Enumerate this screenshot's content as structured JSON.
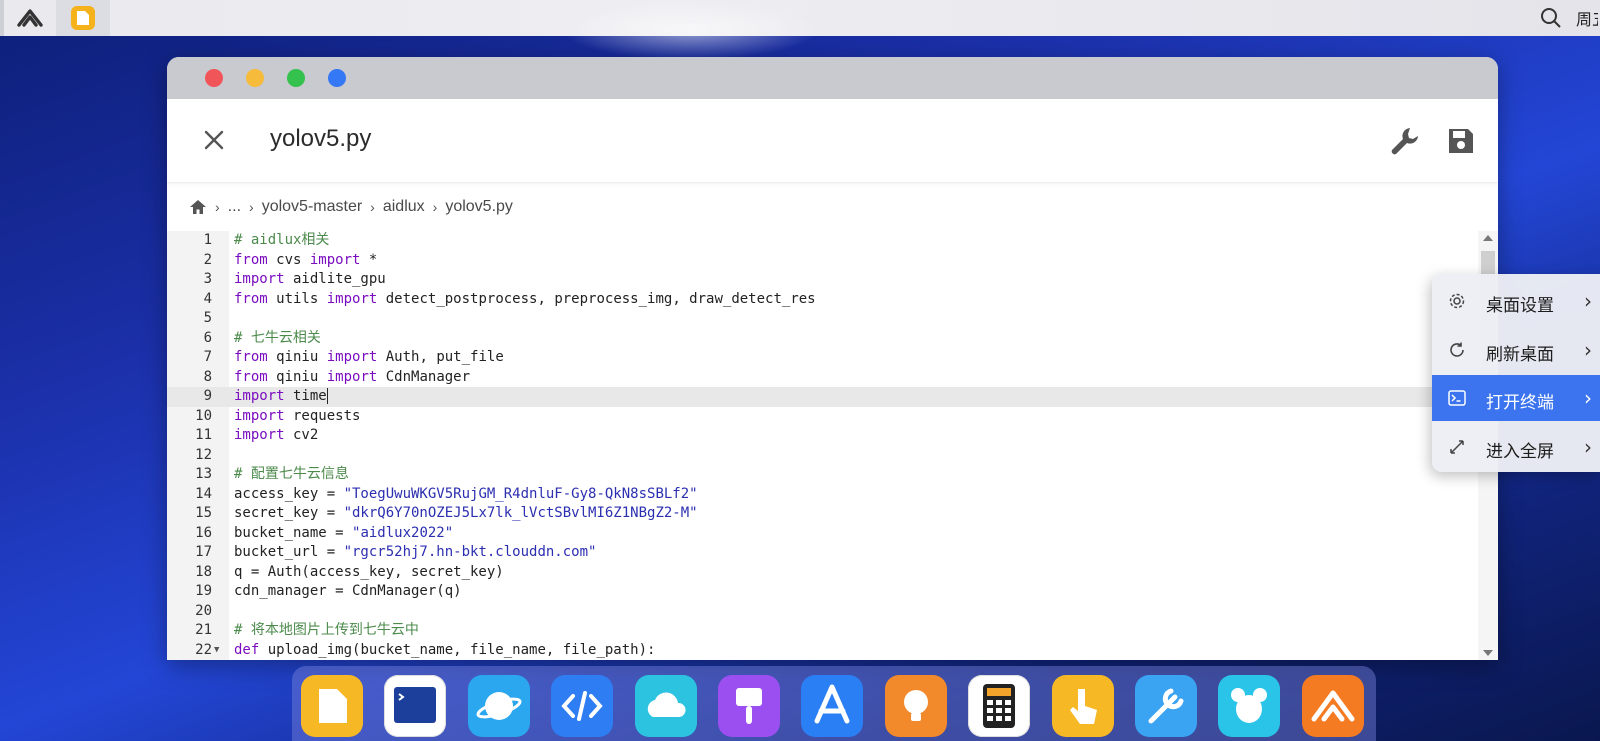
{
  "topbar": {
    "clock": "周五"
  },
  "editor": {
    "filename": "yolov5.py",
    "breadcrumb": [
      "...",
      "yolov5-master",
      "aidlux",
      "yolov5.py"
    ],
    "active_line": 9,
    "lines": [
      {
        "n": "1",
        "t": [
          [
            "cm",
            "# aidlux相关"
          ]
        ]
      },
      {
        "n": "2",
        "t": [
          [
            "kw",
            "from"
          ],
          [
            "p",
            " cvs "
          ],
          [
            "kw",
            "import"
          ],
          [
            "p",
            " *"
          ]
        ]
      },
      {
        "n": "3",
        "t": [
          [
            "kw",
            "import"
          ],
          [
            "p",
            " aidlite_gpu"
          ]
        ]
      },
      {
        "n": "4",
        "t": [
          [
            "kw",
            "from"
          ],
          [
            "p",
            " utils "
          ],
          [
            "kw",
            "import"
          ],
          [
            "p",
            " detect_postprocess, preprocess_img, draw_detect_res"
          ]
        ]
      },
      {
        "n": "5",
        "t": []
      },
      {
        "n": "6",
        "t": [
          [
            "cm",
            "# 七牛云相关"
          ]
        ]
      },
      {
        "n": "7",
        "t": [
          [
            "kw",
            "from"
          ],
          [
            "p",
            " qiniu "
          ],
          [
            "kw",
            "import"
          ],
          [
            "p",
            " Auth, put_file"
          ]
        ]
      },
      {
        "n": "8",
        "t": [
          [
            "kw",
            "from"
          ],
          [
            "p",
            " qiniu "
          ],
          [
            "kw",
            "import"
          ],
          [
            "p",
            " CdnManager"
          ]
        ]
      },
      {
        "n": "9",
        "t": [
          [
            "kw",
            "import"
          ],
          [
            "p",
            " time"
          ],
          [
            "cursor",
            ""
          ]
        ]
      },
      {
        "n": "10",
        "t": [
          [
            "kw",
            "import"
          ],
          [
            "p",
            " requests"
          ]
        ]
      },
      {
        "n": "11",
        "t": [
          [
            "kw",
            "import"
          ],
          [
            "p",
            " cv2"
          ]
        ]
      },
      {
        "n": "12",
        "t": []
      },
      {
        "n": "13",
        "t": [
          [
            "cm",
            "# 配置七牛云信息"
          ]
        ]
      },
      {
        "n": "14",
        "t": [
          [
            "p",
            "access_key = "
          ],
          [
            "st",
            "\"ToegUwuWKGV5RujGM_R4dnluF-Gy8-QkN8sSBLf2\""
          ]
        ]
      },
      {
        "n": "15",
        "t": [
          [
            "p",
            "secret_key = "
          ],
          [
            "st",
            "\"dkrQ6Y70nOZEJ5Lx7lk_lVctSBvlMI6Z1NBgZ2-M\""
          ]
        ]
      },
      {
        "n": "16",
        "t": [
          [
            "p",
            "bucket_name = "
          ],
          [
            "st",
            "\"aidlux2022\""
          ]
        ]
      },
      {
        "n": "17",
        "t": [
          [
            "p",
            "bucket_url = "
          ],
          [
            "st",
            "\"rgcr52hj7.hn-bkt.clouddn.com\""
          ]
        ]
      },
      {
        "n": "18",
        "t": [
          [
            "p",
            "q = Auth(access_key, secret_key)"
          ]
        ]
      },
      {
        "n": "19",
        "t": [
          [
            "p",
            "cdn_manager = CdnManager(q)"
          ]
        ]
      },
      {
        "n": "20",
        "t": []
      },
      {
        "n": "21",
        "t": [
          [
            "cm",
            "# 将本地图片上传到七牛云中"
          ]
        ]
      },
      {
        "n": "22",
        "fold": true,
        "t": [
          [
            "kw",
            "def"
          ],
          [
            "p",
            " upload_img(bucket_name, file_name, file_path):"
          ]
        ]
      }
    ]
  },
  "context_menu": {
    "items": [
      {
        "label": "桌面设置",
        "icon": "gear-icon",
        "selected": false
      },
      {
        "label": "刷新桌面",
        "icon": "refresh-icon",
        "selected": false
      },
      {
        "label": "打开终端",
        "icon": "terminal-icon",
        "selected": true
      },
      {
        "label": "进入全屏",
        "icon": "fullscreen-icon",
        "selected": false
      }
    ]
  },
  "dock": {
    "apps": [
      {
        "icon": "files-app-icon",
        "color": "#f7b825"
      },
      {
        "icon": "terminal-app-icon",
        "color": "#ffffff"
      },
      {
        "icon": "browser-planet-icon",
        "color": "#2aa7ee"
      },
      {
        "icon": "code-editor-icon",
        "color": "#2f7df2"
      },
      {
        "icon": "cloud-icon",
        "color": "#2cc3e0"
      },
      {
        "icon": "paint-brush-icon",
        "color": "#9b4ff0"
      },
      {
        "icon": "app-store-icon",
        "color": "#2a7ff5"
      },
      {
        "icon": "lightbulb-icon",
        "color": "#f28a2b"
      },
      {
        "icon": "calculator-icon",
        "color": "#ffffff"
      },
      {
        "icon": "touch-hand-icon",
        "color": "#f7b825"
      },
      {
        "icon": "tools-icon",
        "color": "#3aa3f2"
      },
      {
        "icon": "mouse-icon",
        "color": "#2ac4e8"
      },
      {
        "icon": "aidlux-logo-icon",
        "color": "#f57b23"
      }
    ]
  }
}
